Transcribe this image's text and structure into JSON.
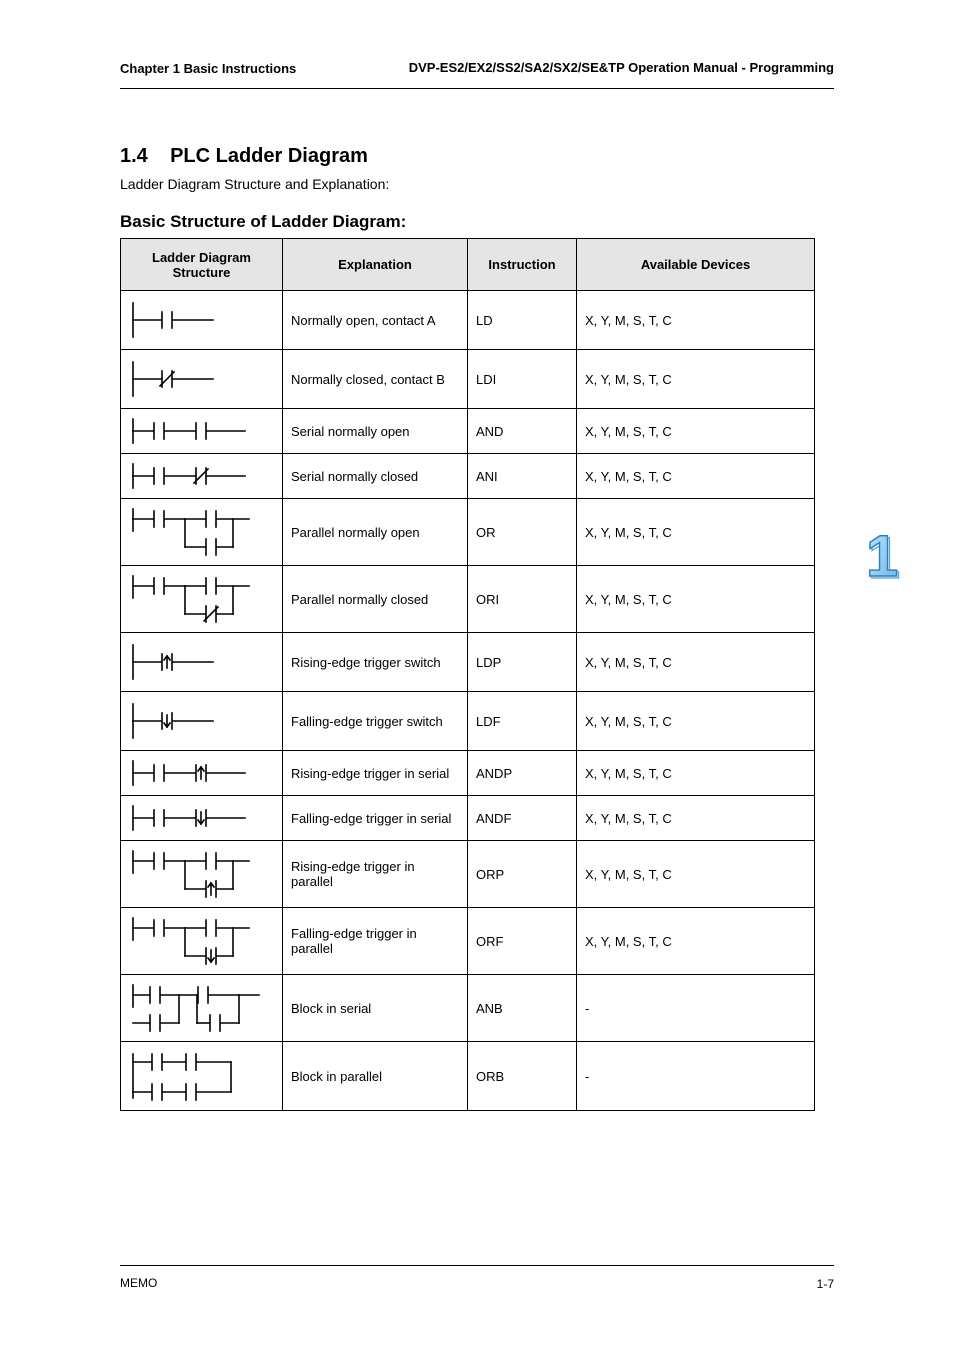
{
  "header": {
    "left": "Chapter 1 Basic Instructions",
    "right": "DVP-ES2/EX2/SS2/SA2/SX2/SE&TP Operation Manual - Programming"
  },
  "section": {
    "number": "1.4",
    "title": "PLC Ladder Diagram",
    "lead": "Ladder Diagram Structure and Explanation:",
    "sub": "Basic Structure of Ladder Diagram:"
  },
  "table": {
    "headers": [
      "Ladder Diagram Structure",
      "Explanation",
      "Instruction",
      "Available Devices"
    ],
    "rows": [
      {
        "diagram": "no",
        "expl": "Normally open, contact A",
        "instr": "LD",
        "dev": "X, Y, M, S, T, C"
      },
      {
        "diagram": "nc",
        "expl": "Normally closed, contact B",
        "instr": "LDI",
        "dev": "X, Y, M, S, T, C"
      },
      {
        "diagram": "and_no",
        "expl": "Serial normally open",
        "instr": "AND",
        "dev": "X, Y, M, S, T, C"
      },
      {
        "diagram": "and_nc",
        "expl": "Serial normally closed",
        "instr": "ANI",
        "dev": "X, Y, M, S, T, C"
      },
      {
        "diagram": "or_no",
        "expl": "Parallel normally open",
        "instr": "OR",
        "dev": "X, Y, M, S, T, C"
      },
      {
        "diagram": "or_nc",
        "expl": "Parallel normally closed",
        "instr": "ORI",
        "dev": "X, Y, M, S, T, C"
      },
      {
        "diagram": "rise",
        "expl": "Rising-edge trigger switch",
        "instr": "LDP",
        "dev": "X, Y, M, S, T, C"
      },
      {
        "diagram": "fall",
        "expl": "Falling-edge trigger switch",
        "instr": "LDF",
        "dev": "X, Y, M, S, T, C"
      },
      {
        "diagram": "and_rise",
        "expl": "Rising-edge trigger in serial",
        "instr": "ANDP",
        "dev": "X, Y, M, S, T, C"
      },
      {
        "diagram": "and_fall",
        "expl": "Falling-edge trigger in serial",
        "instr": "ANDF",
        "dev": "X, Y, M, S, T, C"
      },
      {
        "diagram": "or_rise",
        "expl": "Rising-edge trigger in parallel",
        "instr": "ORP",
        "dev": "X, Y, M, S, T, C"
      },
      {
        "diagram": "or_fall",
        "expl": "Falling-edge trigger in parallel",
        "instr": "ORF",
        "dev": "X, Y, M, S, T, C"
      },
      {
        "diagram": "anb",
        "expl": "Block in serial",
        "instr": "ANB",
        "dev": "-"
      },
      {
        "diagram": "orb",
        "expl": "Block in parallel",
        "instr": "ORB",
        "dev": "-"
      }
    ]
  },
  "sideMark": {
    "digit": "1"
  },
  "footer": {
    "left": "MEMO",
    "right": "1-7"
  }
}
